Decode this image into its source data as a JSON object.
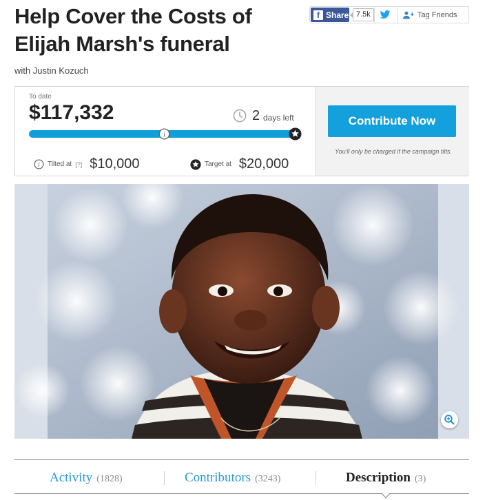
{
  "campaign": {
    "title": "Help Cover the Costs of Elijah Marsh's funeral",
    "byline": "with Justin Kozuch"
  },
  "share": {
    "facebook_label": "Share",
    "facebook_icon": "facebook-icon",
    "facebook_count": "7.5k",
    "twitter_icon": "twitter-icon",
    "tag_label": "Tag Friends",
    "tag_icon": "add-person-icon",
    "colors": {
      "facebook": "#3b5998",
      "twitter": "#1da1f2"
    }
  },
  "funding": {
    "to_date_label": "To date",
    "raised": "$117,332",
    "days_left_number": "2",
    "days_left_label": "days left",
    "progress_fraction": 1.0,
    "tilt_fraction": 0.5,
    "tilted_label": "Tilted at",
    "tilted_help": "[?]",
    "tilted_amount": "$10,000",
    "target_label": "Target at",
    "target_amount": "$20,000",
    "contribute_label": "Contribute Now",
    "charge_note": "You'll only be charged if the campaign tilts.",
    "colors": {
      "accent": "#13a0dc",
      "progress": "#119fd9"
    }
  },
  "photo": {
    "subject": "portrait photo of a smiling toddler",
    "zoom_icon": "zoom-in-icon"
  },
  "tabs": [
    {
      "label": "Activity",
      "count": "(1828)",
      "active": false
    },
    {
      "label": "Contributors",
      "count": "(3243)",
      "active": false
    },
    {
      "label": "Description",
      "count": "(3)",
      "active": true
    }
  ]
}
